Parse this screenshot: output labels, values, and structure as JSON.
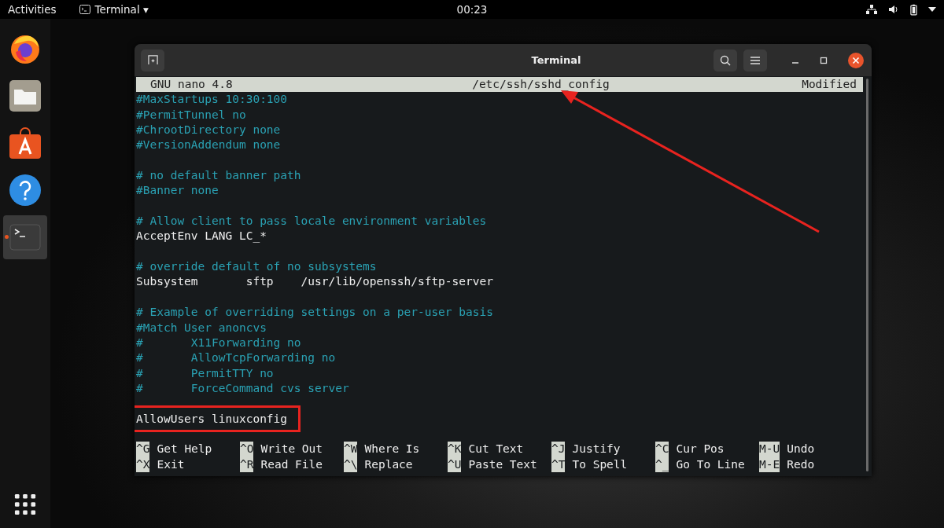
{
  "top_bar": {
    "activities": "Activities",
    "app_menu": "Terminal ▾",
    "clock": "00:23"
  },
  "dock": {
    "items": [
      {
        "kind": "browser",
        "running": false
      },
      {
        "kind": "files",
        "running": false
      },
      {
        "kind": "store",
        "running": false
      },
      {
        "kind": "help",
        "running": false
      },
      {
        "kind": "terminal",
        "running": true
      }
    ]
  },
  "window": {
    "title": "Terminal"
  },
  "nano": {
    "version": "GNU nano 4.8",
    "file": "/etc/ssh/sshd_config",
    "status": "Modified",
    "lines": [
      {
        "kind": "comment",
        "text": "#MaxStartups 10:30:100"
      },
      {
        "kind": "comment",
        "text": "#PermitTunnel no"
      },
      {
        "kind": "comment",
        "text": "#ChrootDirectory none"
      },
      {
        "kind": "comment",
        "text": "#VersionAddendum none"
      },
      {
        "kind": "blank"
      },
      {
        "kind": "comment",
        "text": "# no default banner path"
      },
      {
        "kind": "comment",
        "text": "#Banner none"
      },
      {
        "kind": "blank"
      },
      {
        "kind": "comment",
        "text": "# Allow client to pass locale environment variables"
      },
      {
        "kind": "directive",
        "text": "AcceptEnv LANG LC_*"
      },
      {
        "kind": "blank"
      },
      {
        "kind": "comment",
        "text": "# override default of no subsystems"
      },
      {
        "kind": "directive",
        "text": "Subsystem       sftp    /usr/lib/openssh/sftp-server"
      },
      {
        "kind": "blank"
      },
      {
        "kind": "comment",
        "text": "# Example of overriding settings on a per-user basis"
      },
      {
        "kind": "comment",
        "text": "#Match User anoncvs"
      },
      {
        "kind": "comment",
        "text": "#       X11Forwarding no"
      },
      {
        "kind": "comment",
        "text": "#       AllowTcpForwarding no"
      },
      {
        "kind": "comment",
        "text": "#       PermitTTY no"
      },
      {
        "kind": "comment",
        "text": "#       ForceCommand cvs server"
      },
      {
        "kind": "blank"
      },
      {
        "kind": "directive",
        "text": "AllowUsers linuxconfig",
        "highlighted": true
      },
      {
        "kind": "blank"
      }
    ],
    "shortcuts": [
      [
        {
          "key": "^G",
          "label": "Get Help"
        },
        {
          "key": "^O",
          "label": "Write Out"
        },
        {
          "key": "^W",
          "label": "Where Is"
        },
        {
          "key": "^K",
          "label": "Cut Text"
        },
        {
          "key": "^J",
          "label": "Justify"
        },
        {
          "key": "^C",
          "label": "Cur Pos"
        },
        {
          "key": "M-U",
          "label": "Undo"
        }
      ],
      [
        {
          "key": "^X",
          "label": "Exit"
        },
        {
          "key": "^R",
          "label": "Read File"
        },
        {
          "key": "^\\",
          "label": "Replace"
        },
        {
          "key": "^U",
          "label": "Paste Text"
        },
        {
          "key": "^T",
          "label": "To Spell"
        },
        {
          "key": "^_",
          "label": "Go To Line"
        },
        {
          "key": "M-E",
          "label": "Redo"
        }
      ]
    ]
  },
  "annotation_arrow": {
    "shown": true
  }
}
